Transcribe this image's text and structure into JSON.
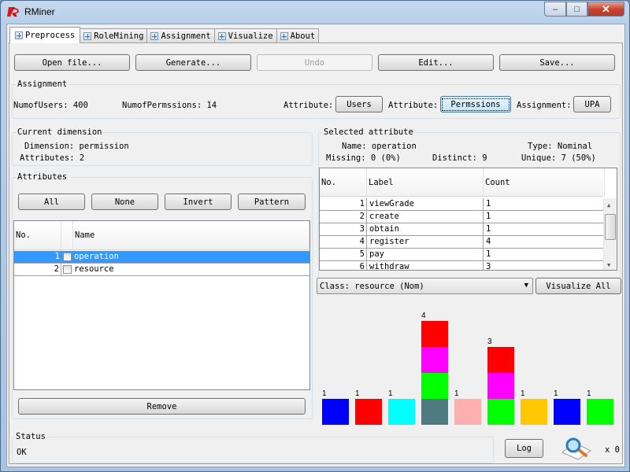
{
  "window": {
    "title": "RMiner",
    "minimize": "–",
    "maximize": "□",
    "close": "✕"
  },
  "tabs": [
    {
      "label": "Preprocess",
      "active": true
    },
    {
      "label": "RoleMining",
      "active": false
    },
    {
      "label": "Assignment",
      "active": false
    },
    {
      "label": "Visualize",
      "active": false
    },
    {
      "label": "About",
      "active": false
    }
  ],
  "toolbar": {
    "open_label": "Open file...",
    "generate_label": "Generate...",
    "undo_label": "Undo",
    "edit_label": "Edit...",
    "save_label": "Save..."
  },
  "assignment": {
    "title": "Assignment",
    "num_users": "NumofUsers: 400",
    "num_perms": "NumofPermssions: 14",
    "attr_label_1": "Attribute:",
    "users_button": "Users",
    "attr_label_2": "Attribute:",
    "perms_button": "Permssions",
    "assign_label": "Assignment:",
    "upa_button": "UPA"
  },
  "current_dimension": {
    "title": "Current dimension",
    "dimension": "Dimension: permission",
    "attributes": "Attributes: 2"
  },
  "attributes_panel": {
    "title": "Attributes",
    "all_label": "All",
    "none_label": "None",
    "invert_label": "Invert",
    "pattern_label": "Pattern",
    "columns": [
      "No.",
      "",
      "Name"
    ],
    "rows": [
      {
        "no": "1",
        "name": "operation",
        "selected": true
      },
      {
        "no": "2",
        "name": "resource",
        "selected": false
      }
    ],
    "remove_label": "Remove"
  },
  "selected_attribute": {
    "title": "Selected attribute",
    "name": "Name: operation",
    "type": "Type: Nominal",
    "missing": "Missing: 0 (0%)",
    "distinct": "Distinct: 9",
    "unique": "Unique: 7 (50%)",
    "columns": [
      "No.",
      "Label",
      "Count"
    ],
    "rows": [
      {
        "no": "1",
        "label": "viewGrade",
        "count": "1"
      },
      {
        "no": "2",
        "label": "create",
        "count": "1"
      },
      {
        "no": "3",
        "label": "obtain",
        "count": "1"
      },
      {
        "no": "4",
        "label": "register",
        "count": "4"
      },
      {
        "no": "5",
        "label": "pay",
        "count": "1"
      },
      {
        "no": "6",
        "label": "withdraw",
        "count": "3"
      }
    ]
  },
  "class_combo": {
    "value": "Class: resource (Nom)"
  },
  "visualize_all_label": "Visualize All",
  "histogram": {
    "values": [
      1,
      1,
      1,
      4,
      1,
      3,
      1,
      1,
      1
    ],
    "labels": [
      "1",
      "1",
      "1",
      "4",
      "1",
      "3",
      "1",
      "1",
      "1"
    ],
    "segments": [
      [
        "#0000ff"
      ],
      [
        "#ff0000"
      ],
      [
        "#00ffff"
      ],
      [
        "#4f7a80",
        "#00ff00",
        "#ff00ff",
        "#ff0000"
      ],
      [
        "#ffafaf"
      ],
      [
        "#00ff00",
        "#ff00ff",
        "#ff0000"
      ],
      [
        "#ffc800"
      ],
      [
        "#0000ff"
      ],
      [
        "#00ff00"
      ]
    ]
  },
  "status": {
    "title": "Status",
    "text": "OK",
    "log_label": "Log",
    "count": "x 0"
  }
}
